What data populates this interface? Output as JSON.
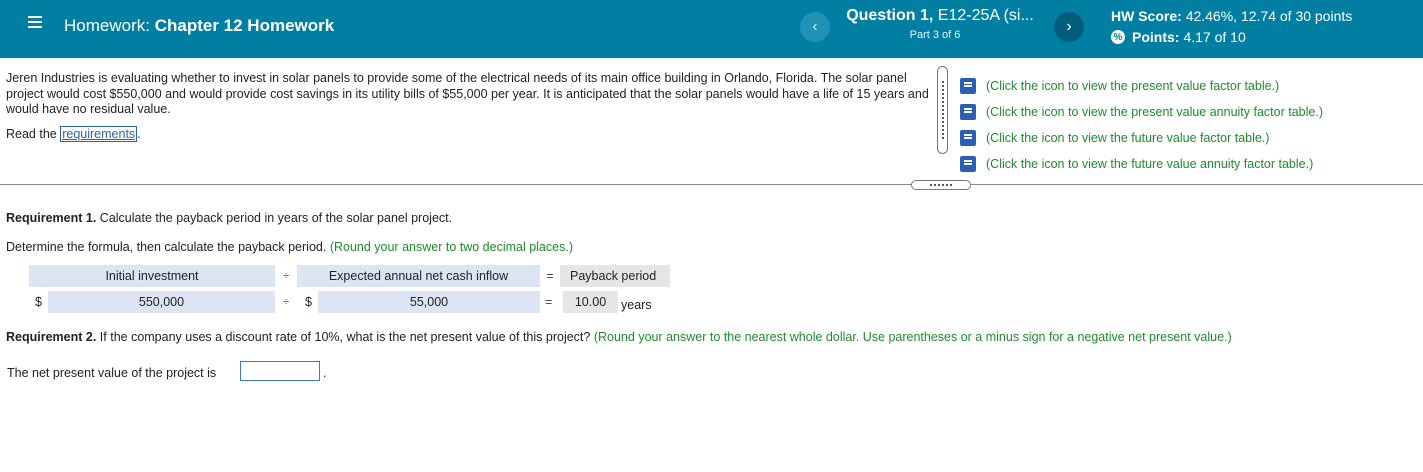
{
  "header": {
    "homework_prefix": "Homework:",
    "homework_name": "Chapter 12 Homework",
    "question_label": "Question 1,",
    "question_id": "E12-25A (si...",
    "part": "Part 3 of 6",
    "prev_symbol": "‹",
    "next_symbol": "›",
    "hw_score_label": "HW Score:",
    "hw_score_value": "42.46%, 12.74 of 30 points",
    "points_label": "Points:",
    "points_value": "4.17 of 10"
  },
  "problem": {
    "text": "Jeren Industries is evaluating whether to invest in solar panels to provide some of the electrical needs of its main office building in Orlando, Florida. The solar panel project would cost $550,000 and would provide cost savings in its utility bills of $55,000 per year. It is anticipated that the solar panels would have a life of 15 years and would have no residual value.",
    "read_prefix": "Read the",
    "requirements_link": "requirements",
    "read_suffix": "."
  },
  "resources": [
    {
      "label": "(Click the icon to view the present value factor table.)"
    },
    {
      "label": "(Click the icon to view the present value annuity factor table.)"
    },
    {
      "label": "(Click the icon to view the future value factor table.)"
    },
    {
      "label": "(Click the icon to view the future value annuity factor table.)"
    }
  ],
  "requirement1": {
    "title": "Requirement 1.",
    "text": "Calculate the payback period in years of the solar panel project.",
    "instruction": "Determine the formula, then calculate the payback period.",
    "hint": "(Round your answer to two decimal places.)",
    "headers": {
      "initial_investment": "Initial investment",
      "divide": "÷",
      "cash_inflow": "Expected annual net cash inflow",
      "equals": "=",
      "payback": "Payback period"
    },
    "row": {
      "dollar1": "$",
      "initial_value": "550,000",
      "divide": "÷",
      "dollar2": "$",
      "cash_value": "55,000",
      "equals": "=",
      "payback_value": "10.00",
      "unit": "years"
    }
  },
  "requirement2": {
    "title": "Requirement 2.",
    "text": "If the company uses a discount rate of 10%, what is the net present value of this project?",
    "hint": "(Round your answer to the nearest whole dollar. Use parentheses or a minus sign for a negative net present value.)",
    "npv_label": "The net present value of the project is",
    "npv_value": "",
    "npv_period": "."
  },
  "colors": {
    "header_bg": "#007fa3",
    "hint_green": "#1f8a2d",
    "link_blue": "#2b62b0",
    "table_blue": "#dde4f3"
  }
}
